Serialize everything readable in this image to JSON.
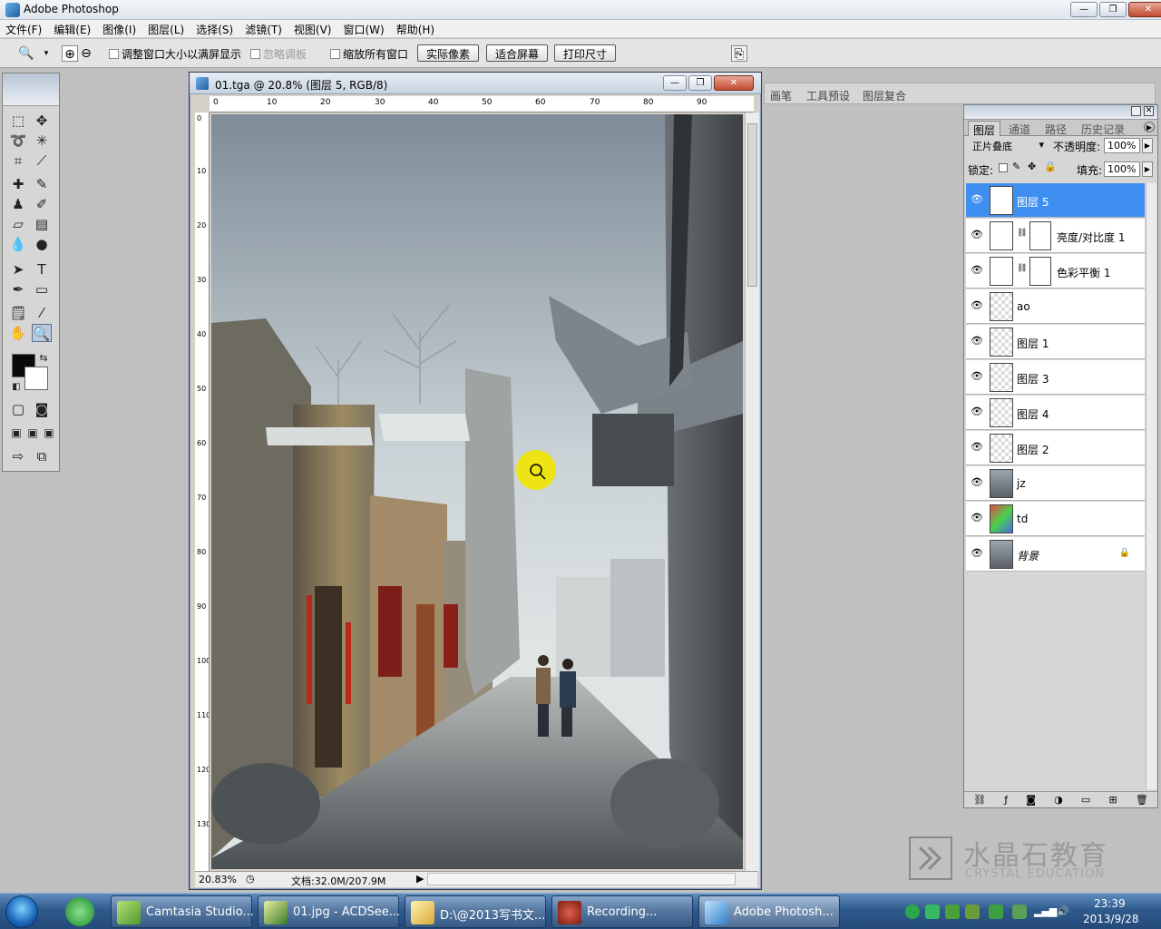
{
  "app": {
    "title": "Adobe Photoshop"
  },
  "menu": [
    "文件(F)",
    "编辑(E)",
    "图像(I)",
    "图层(L)",
    "选择(S)",
    "滤镜(T)",
    "视图(V)",
    "窗口(W)",
    "帮助(H)"
  ],
  "options": {
    "resize_windows": "调整窗口大小以满屏显示",
    "ignore_palettes": "忽略调板",
    "zoom_all_windows": "缩放所有窗口",
    "actual_pixels": "实际像素",
    "fit_screen": "适合屏幕",
    "print_size": "打印尺寸"
  },
  "palette_well": [
    "画笔",
    "工具预设",
    "图层复合"
  ],
  "document": {
    "title": "01.tga @ 20.8% (图层 5, RGB/8)",
    "zoom": "20.83%",
    "doc_size": "文档:32.0M/207.9M",
    "ruler_top": [
      "0",
      "10",
      "20",
      "30",
      "40",
      "50",
      "60",
      "70",
      "80",
      "90"
    ],
    "ruler_left": [
      "0",
      "10",
      "20",
      "30",
      "40",
      "50",
      "60",
      "70",
      "80",
      "90",
      "100",
      "110",
      "120",
      "130"
    ]
  },
  "layers_panel": {
    "tabs": [
      "图层",
      "通道",
      "路径",
      "历史记录"
    ],
    "blend_mode": "正片叠底",
    "opacity_label": "不透明度:",
    "opacity": "100%",
    "lock_label": "锁定:",
    "fill_label": "填充:",
    "fill": "100%",
    "layers": [
      {
        "name": "图层 5",
        "selected": true
      },
      {
        "name": "亮度/对比度 1",
        "selected": false
      },
      {
        "name": "色彩平衡 1",
        "selected": false
      },
      {
        "name": "ao",
        "selected": false
      },
      {
        "name": "图层 1",
        "selected": false
      },
      {
        "name": "图层 3",
        "selected": false
      },
      {
        "name": "图层 4",
        "selected": false
      },
      {
        "name": "图层 2",
        "selected": false
      },
      {
        "name": "jz",
        "selected": false
      },
      {
        "name": "td",
        "selected": false
      },
      {
        "name": "背景",
        "selected": false
      }
    ]
  },
  "watermark": {
    "cn": "水晶石教育",
    "en": "CRYSTAL EDUCATION"
  },
  "taskbar": {
    "tasks": [
      "Camtasia Studio...",
      "01.jpg - ACDSee...",
      "D:\\@2013写书文...",
      "Recording...",
      "Adobe Photosh..."
    ],
    "time": "23:39",
    "date": "2013/9/28"
  },
  "colors": {
    "selection": "#3f8ff0",
    "taskbar": "#2f5a8c",
    "highlight_cursor": "#f2e600"
  }
}
